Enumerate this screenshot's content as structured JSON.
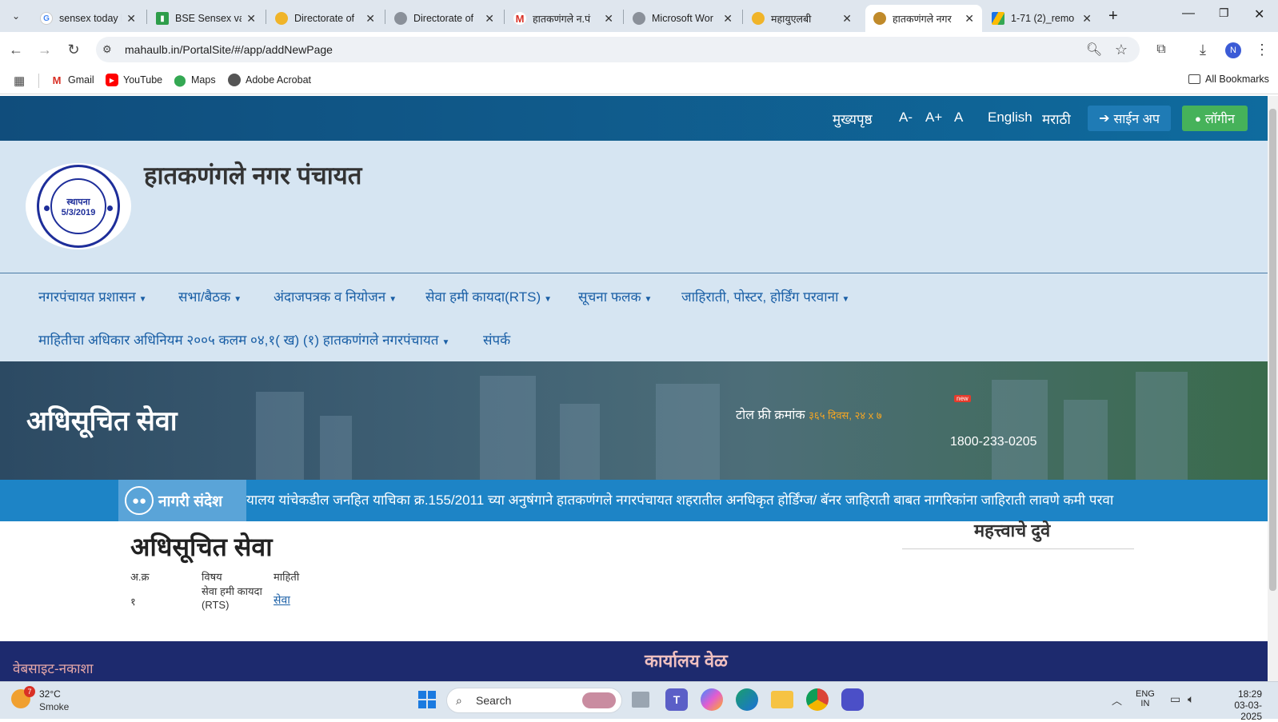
{
  "browser": {
    "tabs": [
      {
        "title": "sensex today li",
        "icon": "google-icon"
      },
      {
        "title": "BSE Sensex val",
        "icon": "chart-icon"
      },
      {
        "title": "Directorate of",
        "icon": "emblem-icon"
      },
      {
        "title": "Directorate of",
        "icon": "globe-icon"
      },
      {
        "title": "हातकणंगले न.पं",
        "icon": "gmail-icon"
      },
      {
        "title": "Microsoft Wor",
        "icon": "globe-icon"
      },
      {
        "title": "महायुएलबी",
        "icon": "emblem-icon"
      },
      {
        "title": "हातकणंगले नगर",
        "icon": "site-icon"
      },
      {
        "title": "1-71 (2)_remo",
        "icon": "drive-icon"
      }
    ],
    "url": "mahaulb.in/PortalSite/#/app/addNewPage",
    "bookmarks": [
      "Gmail",
      "YouTube",
      "Maps",
      "Adobe Acrobat"
    ],
    "all_bookmarks": "All Bookmarks",
    "profile_initial": "N"
  },
  "site": {
    "topnav": {
      "home": "मुख्यपृष्ठ",
      "font_minus": "A-",
      "font_plus": "A+",
      "font_normal": "A",
      "english": "English",
      "marathi": "मराठी",
      "signup": "साईन अप",
      "login": "लॉगीन"
    },
    "logo": {
      "line1": "स्थापना",
      "line2": "5/3/2019"
    },
    "org_title": "हातकणंगले नगर पंचायत",
    "menu": [
      {
        "label": "नगरपंचायत प्रशासन",
        "dropdown": true
      },
      {
        "label": "सभा/बैठक",
        "dropdown": true
      },
      {
        "label": "अंदाजपत्रक व नियोजन",
        "dropdown": true
      },
      {
        "label": "सेवा हमी कायदा(RTS)",
        "dropdown": true
      },
      {
        "label": "सूचना फलक",
        "dropdown": true
      },
      {
        "label": "जाहिराती, पोस्टर, होर्डिंग परवाना",
        "dropdown": true
      },
      {
        "label": "माहितीचा अधिकार अधिनियम २००५ कलम ०४,१( ख) (१) हातकणंगले नगरपंचायत",
        "dropdown": true
      },
      {
        "label": "संपर्क",
        "dropdown": false
      }
    ],
    "banner": {
      "title": "अधिसूचित सेवा",
      "toll_label": "टोल फ्री क्रमांक",
      "toll_hours": "३६५ दिवस, २४ x ७",
      "new_badge": "new",
      "toll_number": "1800-233-0205"
    },
    "ticker": {
      "label": "नागरी संदेश",
      "text": "यालय यांचेकडील जनहित याचिका क्र.155/2011 च्या अनुषंगाने हातकणंगले नगरपंचायत शहरातील अनधिकृत होर्डिंग्ज/ बॅनर जाहिराती बाबत नागरिकांना जाहिराती लावणे कमी परवा"
    },
    "content": {
      "title": "अधिसूचित सेवा",
      "table": {
        "headers": [
          "अ.क्र",
          "विषय",
          "माहिती"
        ],
        "rows": [
          {
            "no": "१",
            "subject": "सेवा हमी कायदा (RTS)",
            "info": "सेवा"
          }
        ]
      },
      "side_title": "महत्त्वाचे दुवे"
    },
    "footer": {
      "left": "वेबसाइट-नकाशा",
      "center": "कार्यालय वेळ"
    }
  },
  "taskbar": {
    "weather_temp": "32°C",
    "weather_desc": "Smoke",
    "weather_badge": "7",
    "search": "Search",
    "lang_top": "ENG",
    "lang_bottom": "IN",
    "time": "18:29",
    "date": "03-03-2025"
  },
  "colors": {
    "site_header_blue": "#104d7c",
    "menu_bg": "#d6e5f2",
    "menu_link": "#1a5fa6",
    "ticker_blue": "#1d84c6",
    "login_green": "#46b25a",
    "footer_navy": "#1d2a6e"
  }
}
